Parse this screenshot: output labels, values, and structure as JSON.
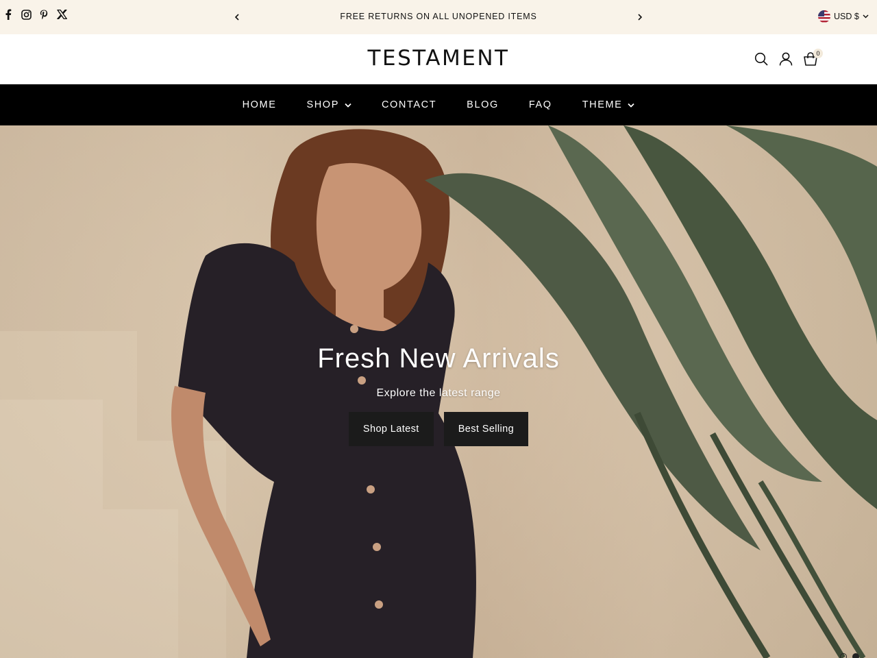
{
  "announcement": {
    "text": "FREE RETURNS ON ALL UNOPENED ITEMS",
    "currency": "USD $",
    "social_icons": [
      "facebook-icon",
      "instagram-icon",
      "pinterest-icon",
      "x-icon"
    ]
  },
  "header": {
    "logo": "TESTAMENT",
    "cart_count": "0",
    "icons": [
      "search-icon",
      "account-icon",
      "cart-icon"
    ]
  },
  "nav": {
    "items": [
      {
        "label": "HOME"
      },
      {
        "label": "SHOP"
      },
      {
        "label": "CONTACT"
      },
      {
        "label": "BLOG"
      },
      {
        "label": "FAQ"
      },
      {
        "label": "THEME"
      }
    ]
  },
  "hero": {
    "title": "Fresh New Arrivals",
    "subtitle": "Explore the latest range",
    "buttons": [
      {
        "label": "Shop Latest"
      },
      {
        "label": "Best Selling"
      }
    ],
    "slides": 2,
    "active_slide": 2
  },
  "colors": {
    "announcement_bg": "#f9f3e9",
    "nav_bg": "#000000",
    "button_bg": "#1b1b1b"
  }
}
